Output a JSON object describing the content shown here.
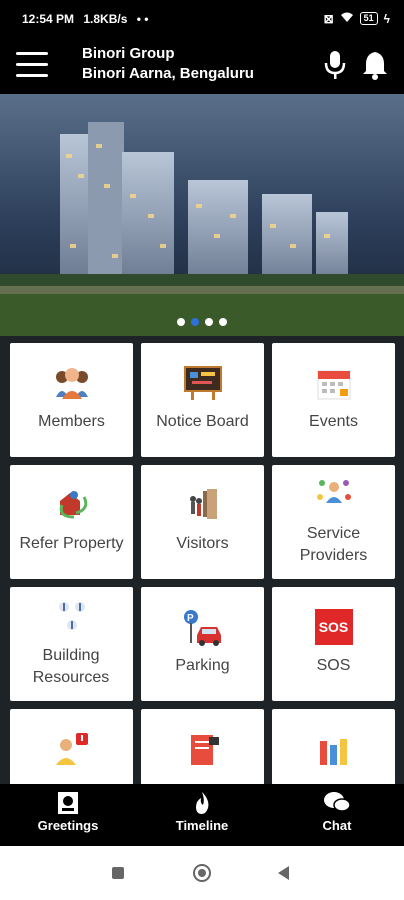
{
  "status": {
    "time": "12:54 PM",
    "speed": "1.8KB/s",
    "battery": "51"
  },
  "header": {
    "org": "Binori Group",
    "location": "Binori Aarna, Bengaluru"
  },
  "carousel": {
    "count": 4,
    "active_index": 1
  },
  "tiles": [
    {
      "label": "Members",
      "icon": "members-icon"
    },
    {
      "label": "Notice Board",
      "icon": "notice-board-icon"
    },
    {
      "label": "Events",
      "icon": "calendar-icon"
    },
    {
      "label": "Refer Property",
      "icon": "refer-property-icon"
    },
    {
      "label": "Visitors",
      "icon": "visitors-icon"
    },
    {
      "label": "Service Providers",
      "icon": "service-providers-icon"
    },
    {
      "label": "Building Resources",
      "icon": "building-resources-icon"
    },
    {
      "label": "Parking",
      "icon": "parking-icon"
    },
    {
      "label": "SOS",
      "icon": "sos-icon"
    }
  ],
  "bottom_nav": [
    {
      "label": "Greetings",
      "icon": "greetings-icon"
    },
    {
      "label": "Timeline",
      "icon": "flame-icon"
    },
    {
      "label": "Chat",
      "icon": "chat-icon"
    }
  ],
  "sos_text": "SOS"
}
